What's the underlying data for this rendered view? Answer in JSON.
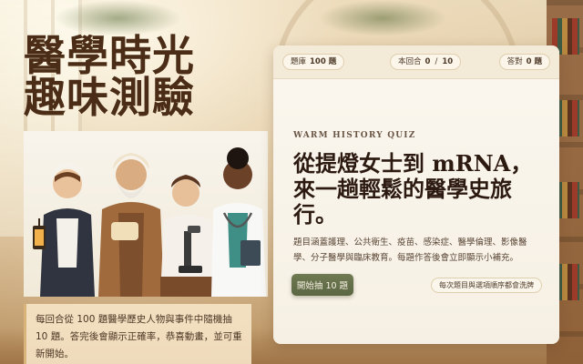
{
  "page": {
    "title_line1": "醫學時光",
    "title_line2": "趣味測驗",
    "description": "每回合從 100 題醫學歷史人物與事件中隨機抽 10 題。答完後會顯示正確率，恭喜動畫，並可重新開始。"
  },
  "stats": {
    "bank_label": "題庫",
    "bank_value": "100 題",
    "round_label": "本回合",
    "round_current": "0",
    "round_sep": "/",
    "round_total": "10",
    "correct_label": "答對",
    "correct_value": "0 題"
  },
  "card": {
    "kicker": "WARM HISTORY QUIZ",
    "headline": "從提燈女士到 mRNA，來一趟輕鬆的醫學史旅行。",
    "body": "題目涵蓋護理、公共衛生、疫苗、感染症、醫學倫理、影像醫學、分子醫學與臨床教育。每題作答後會立即顯示小補充。",
    "start_label": "開始抽 10 題",
    "shuffle_note": "每次題目與選項順序都會洗牌"
  }
}
